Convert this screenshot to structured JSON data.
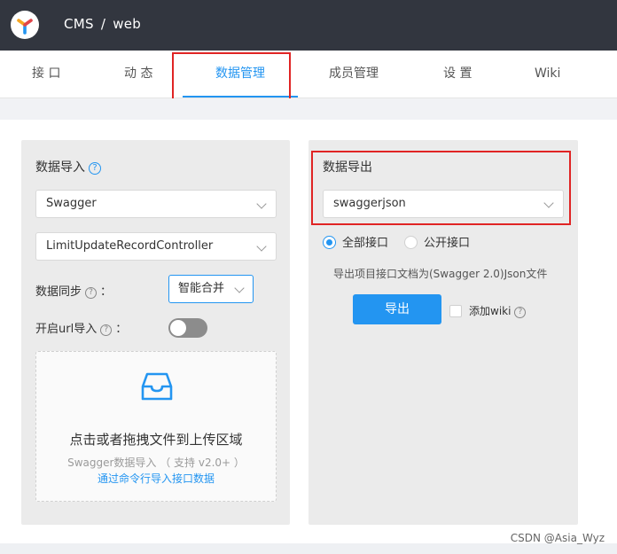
{
  "header": {
    "project": "CMS",
    "separator": "/",
    "group": "web"
  },
  "tabs": [
    {
      "label": "接 口",
      "active": false
    },
    {
      "label": "动 态",
      "active": false
    },
    {
      "label": "数据管理",
      "active": true
    },
    {
      "label": "成员管理",
      "active": false
    },
    {
      "label": "设 置",
      "active": false
    },
    {
      "label": "Wiki",
      "active": false
    }
  ],
  "import_panel": {
    "title": "数据导入",
    "help": "?",
    "type_select": "Swagger",
    "controller_select": "LimitUpdateRecordController",
    "sync_label": "数据同步",
    "sync_colon": "：",
    "sync_value": "智能合并",
    "url_import_label": "开启url导入",
    "url_import_colon": "：",
    "url_import_enabled": false,
    "dropzone": {
      "icon": "inbox-icon",
      "title": "点击或者拖拽文件到上传区域",
      "hint": "Swagger数据导入 （ 支持 v2.0+ ）",
      "link": "通过命令行导入接口数据"
    }
  },
  "export_panel": {
    "title": "数据导出",
    "format_select": "swaggerjson",
    "radios": [
      {
        "label": "全部接口",
        "checked": true
      },
      {
        "label": "公开接口",
        "checked": false
      }
    ],
    "description": "导出项目接口文档为(Swagger 2.0)Json文件",
    "export_button": "导出",
    "add_wiki_label": "添加wiki",
    "add_wiki_checked": false
  },
  "watermark": "CSDN @Asia_Wyz",
  "colors": {
    "accent": "#2395f1",
    "topbar": "#32363f",
    "highlight_red": "#e02424"
  }
}
